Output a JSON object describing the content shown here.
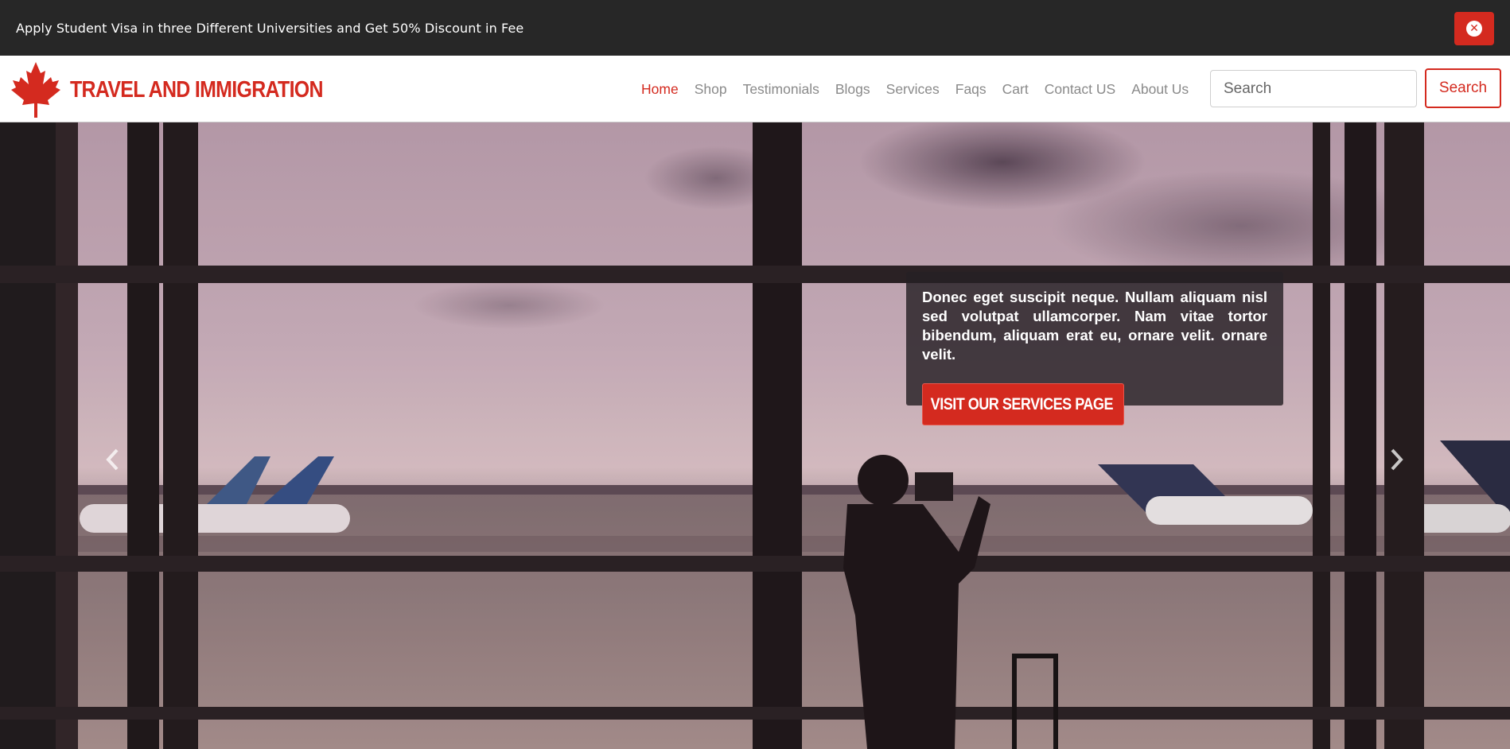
{
  "announcement": {
    "text": "Apply Student Visa in three Different Universities and Get 50% Discount in Fee",
    "close_icon": "times-circle-icon"
  },
  "brand": {
    "name": "TRAVEL AND IMMIGRATION",
    "logo_icon": "maple-leaf-icon"
  },
  "nav": {
    "items": [
      {
        "label": "Home",
        "active": true
      },
      {
        "label": "Shop"
      },
      {
        "label": "Testimonials"
      },
      {
        "label": "Blogs"
      },
      {
        "label": "Services"
      },
      {
        "label": "Faqs"
      },
      {
        "label": "Cart"
      },
      {
        "label": "Contact US"
      },
      {
        "label": "About Us"
      }
    ]
  },
  "search": {
    "placeholder": "Search",
    "button_label": "Search"
  },
  "hero": {
    "caption": "Donec eget suscipit neque. Nullam aliquam nisl sed volutpat ullamcorper. Nam vitae tortor bibendum, aliquam erat eu, ornare velit. ornare velit.",
    "cta_label": "VISIT OUR SERVICES PAGE",
    "cta_icon": "chevron-right-icon",
    "prev_icon": "chevron-left-icon",
    "next_icon": "chevron-right-icon"
  },
  "colors": {
    "accent": "#d42a1f",
    "topbar": "#272727"
  }
}
